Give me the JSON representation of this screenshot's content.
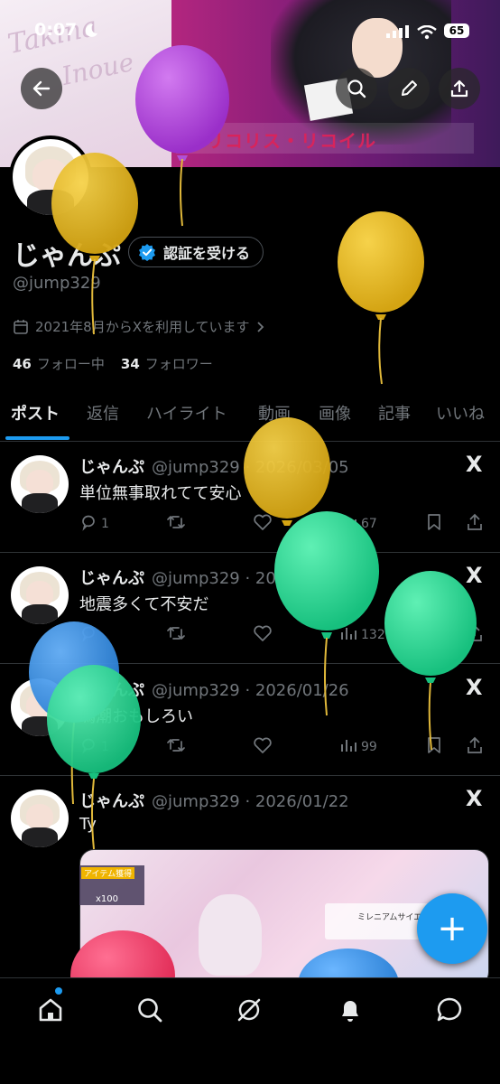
{
  "status_bar": {
    "time": "0:07",
    "battery": "65"
  },
  "banner": {
    "script_line1": "Takina",
    "script_line2": "Inoue",
    "logo_text": "リコリス・リコイル"
  },
  "profile": {
    "display_name": "じゃんぷ",
    "verify_label": "認証を受ける",
    "username": "@jump329",
    "joined": "2021年8月からXを利用しています",
    "following_count": "46",
    "following_label": "フォロー中",
    "followers_count": "34",
    "followers_label": "フォロワー"
  },
  "tabs": [
    {
      "label": "ポスト"
    },
    {
      "label": "返信"
    },
    {
      "label": "ハイライト"
    },
    {
      "label": "動画"
    },
    {
      "label": "画像"
    },
    {
      "label": "記事"
    },
    {
      "label": "いいね"
    }
  ],
  "posts": [
    {
      "name": "じゃんぷ",
      "meta": "@jump329 · 2026/03/05",
      "text": "単位無事取れてて安心",
      "replies": "1",
      "views": "67"
    },
    {
      "name": "じゃんぷ",
      "meta": "@jump329 · 2026/02/07",
      "text": "地震多くて不安だ",
      "replies": "",
      "views": "1327"
    },
    {
      "name": "じゃんぷ",
      "meta": "@jump329 · 2026/01/26",
      "text": "鳴潮おもしろい",
      "replies": "1",
      "views": "99"
    },
    {
      "name": "じゃんぷ",
      "meta": "@jump329 · 2026/01/22",
      "text": "Ty",
      "replies": "",
      "views": ""
    }
  ],
  "media": {
    "badge_title": "アイテム獲得",
    "badge_count": "x100",
    "sign_text": "ミレニアムサイエンススクール"
  },
  "x_logo": "X",
  "fab_label": "+",
  "colors": {
    "accent": "#1d9bf0",
    "background": "#000000",
    "muted": "#71767b",
    "text": "#e7e9ea"
  },
  "icons": [
    "back-arrow-icon",
    "search-icon",
    "edit-pencil-icon",
    "share-icon",
    "verified-badge-icon",
    "calendar-icon",
    "reply-icon",
    "repost-icon",
    "like-icon",
    "views-icon",
    "bookmark-icon",
    "home-icon",
    "explore-icon",
    "grok-icon",
    "notifications-icon",
    "messages-icon"
  ]
}
